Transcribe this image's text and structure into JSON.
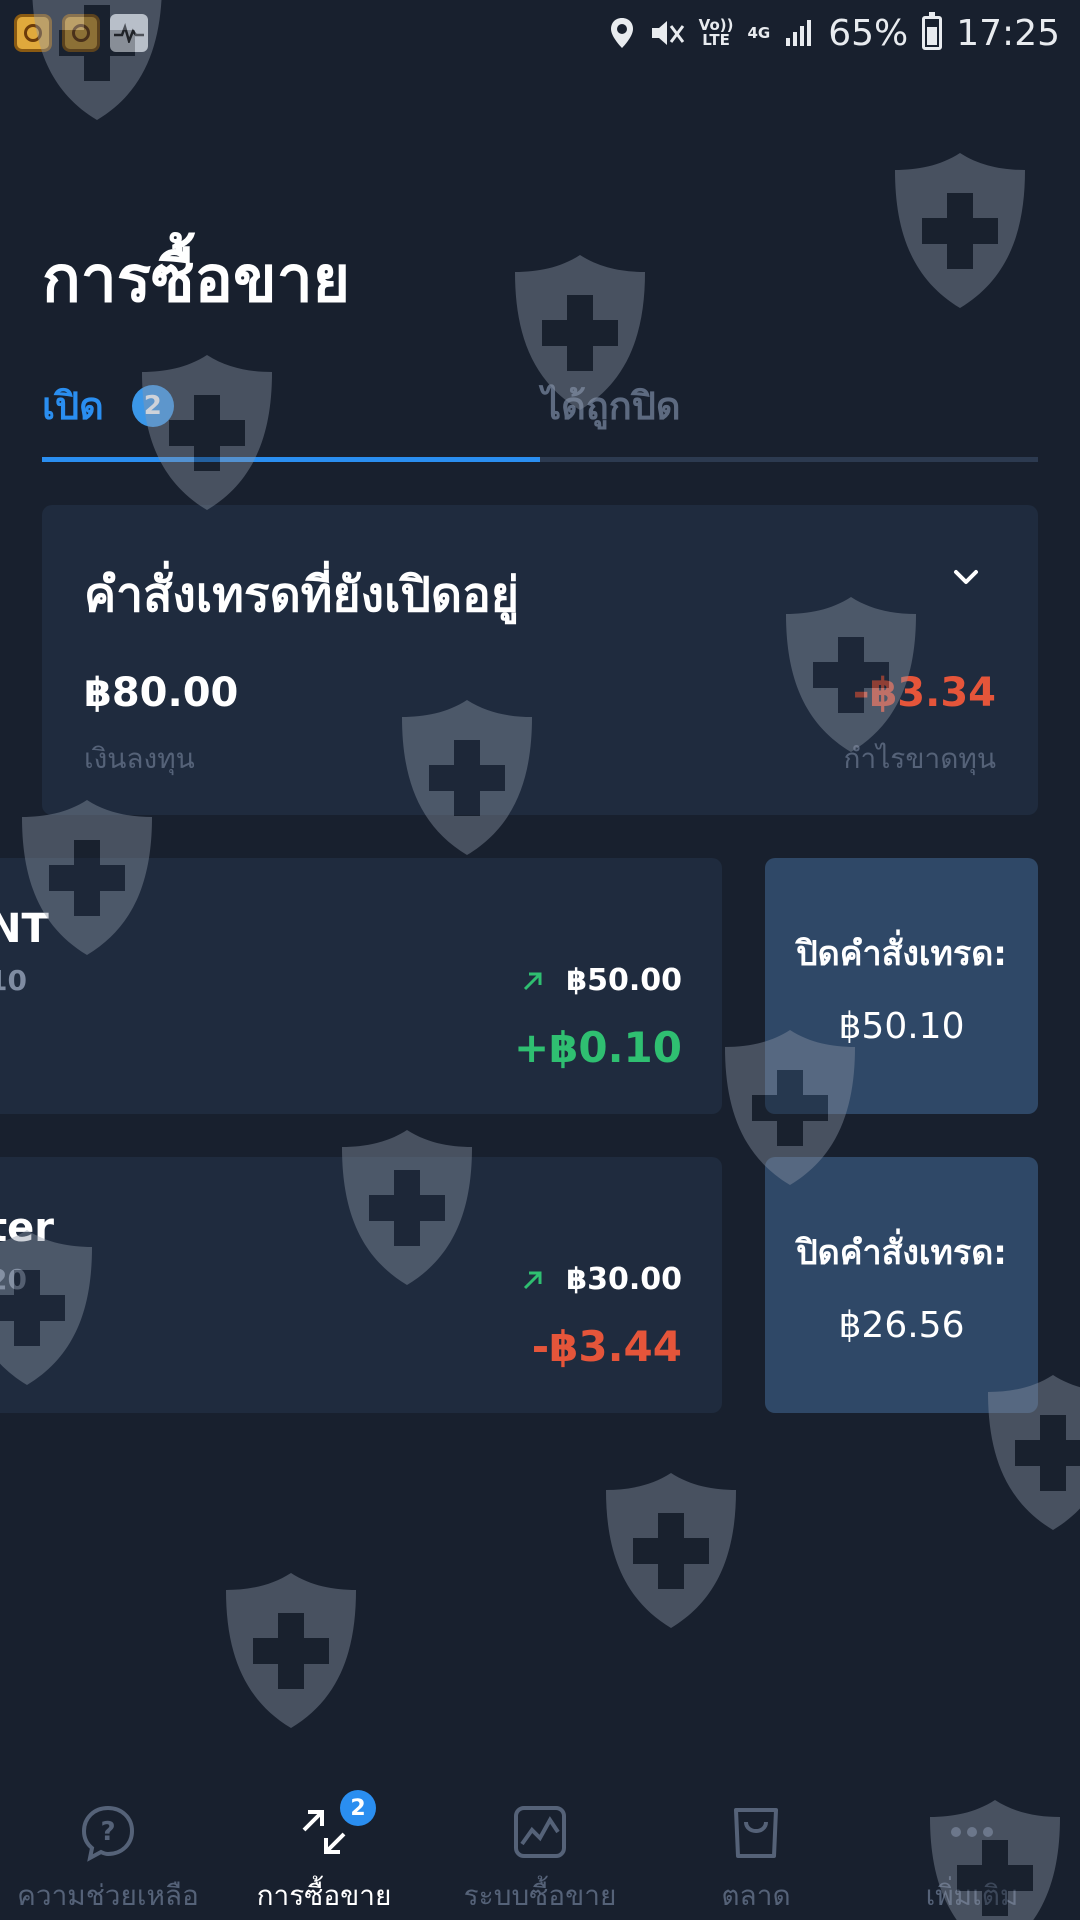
{
  "status_bar": {
    "volte_line1": "Vo))",
    "volte_line2": "LTE",
    "network": "4G",
    "battery_percent": "65%",
    "time": "17:25"
  },
  "page": {
    "title": "การซื้อขาย"
  },
  "tabs": {
    "open_label": "เปิด",
    "open_count": "2",
    "closed_label": "ได้ถูกปิด"
  },
  "summary": {
    "title": "คำสั่งเทรดที่ยังเปิดอยู่",
    "investment_value": "฿80.00",
    "investment_label": "เงินลงทุน",
    "pl_value": "-฿3.34",
    "pl_label": "กำไรขาดทุน"
  },
  "trades": [
    {
      "name": "NT",
      "sub": "10",
      "amount": "฿50.00",
      "pl": "+฿0.10",
      "close_label": "ปิดคำสั่งเทรด:",
      "close_value": "฿50.10"
    },
    {
      "name": "ter",
      "sub": "20",
      "amount": "฿30.00",
      "pl": "-฿3.44",
      "close_label": "ปิดคำสั่งเทรด:",
      "close_value": "฿26.56"
    }
  ],
  "bottom_nav": {
    "help": "ความช่วยเหลือ",
    "trading": "การซื้อขาย",
    "trading_badge": "2",
    "system": "ระบบซื้อขาย",
    "market": "ตลาด",
    "more": "เพิ่มเติม"
  },
  "colors": {
    "background": "#18202e",
    "card": "#1f2b3e",
    "accent_blue": "#2a8ef0",
    "profit_green": "#2fbf71",
    "loss_red": "#e5553a",
    "close_button": "#2f4867"
  }
}
